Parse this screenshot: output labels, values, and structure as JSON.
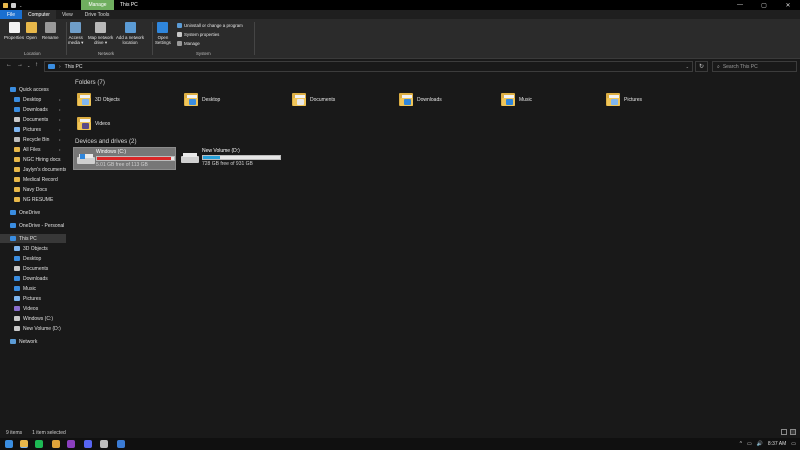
{
  "titlebar": {
    "title": "This PC",
    "manage_tab": "Manage",
    "drive_tools_tab": "Drive Tools",
    "quick_access_icons": [
      "properties-icon",
      "folder-icon",
      "page-icon",
      "dropdown-icon"
    ],
    "window_controls": {
      "minimize": "—",
      "maximize": "▢",
      "close": "✕"
    }
  },
  "tabs": [
    "File",
    "Computer",
    "View",
    "Drive Tools"
  ],
  "ribbon": {
    "location": {
      "label": "Location",
      "buttons": [
        {
          "label": "Properties",
          "icon": "properties-icon",
          "color": "#f2f2f2"
        },
        {
          "label": "Open",
          "icon": "open-folder-icon",
          "color": "#e8b84a"
        },
        {
          "label": "Rename",
          "icon": "rename-icon",
          "color": "#9a9a9a"
        }
      ]
    },
    "network": {
      "label": "Network",
      "buttons": [
        {
          "label": "Access\nmedia ▾",
          "icon": "access-media-icon",
          "color": "#6f9ec9"
        },
        {
          "label": "Map network\ndrive ▾",
          "icon": "map-network-drive-icon",
          "color": "#b9b9b9"
        },
        {
          "label": "Add a network\nlocation",
          "icon": "add-network-location-icon",
          "color": "#5b9bd5"
        }
      ]
    },
    "system": {
      "label": "System",
      "buttons": [
        {
          "label": "Open\nSettings",
          "icon": "settings-icon",
          "color": "#2f86dc"
        }
      ],
      "small": [
        "Uninstall or change a program",
        "System properties",
        "Manage"
      ]
    }
  },
  "address": {
    "crumb": "This PC",
    "search_placeholder": "Search This PC",
    "nav": {
      "back": "←",
      "forward": "→",
      "recent": "⌄",
      "up": "↑",
      "refresh": "↻",
      "search_icon": "⌕",
      "dropdown": "⌄"
    }
  },
  "navpane": {
    "pin_glyph": "📌",
    "items": [
      {
        "label": "Quick access",
        "icon": "star-icon",
        "color": "#3a8de0",
        "pinned": false,
        "selected": false
      },
      {
        "label": "Desktop",
        "icon": "desktop-icon",
        "color": "#3a8de0",
        "pinned": true,
        "selected": false
      },
      {
        "label": "Downloads",
        "icon": "downloads-icon",
        "color": "#3a8de0",
        "pinned": true,
        "selected": false
      },
      {
        "label": "Documents",
        "icon": "documents-icon",
        "color": "#c9c9c9",
        "pinned": true,
        "selected": false
      },
      {
        "label": "Pictures",
        "icon": "pictures-icon",
        "color": "#7fb6f0",
        "pinned": true,
        "selected": false
      },
      {
        "label": "Recycle Bin",
        "icon": "recycle-bin-icon",
        "color": "#bdbdbd",
        "pinned": true,
        "selected": false
      },
      {
        "label": "All Files",
        "icon": "folder-icon",
        "color": "#e8b84a",
        "pinned": true,
        "selected": false
      },
      {
        "label": "NGC Hiring docs",
        "icon": "folder-icon",
        "color": "#e8b84a",
        "pinned": false,
        "selected": false
      },
      {
        "label": "Jaylyn's documents",
        "icon": "folder-icon",
        "color": "#e8b84a",
        "pinned": false,
        "selected": false
      },
      {
        "label": "Medical Record",
        "icon": "folder-icon",
        "color": "#e8b84a",
        "pinned": false,
        "selected": false
      },
      {
        "label": "Navy Docs",
        "icon": "folder-icon",
        "color": "#e8b84a",
        "pinned": false,
        "selected": false
      },
      {
        "label": "NG RESUME",
        "icon": "folder-icon",
        "color": "#e8b84a",
        "pinned": false,
        "selected": false
      },
      {
        "label": "OneDrive",
        "icon": "onedrive-icon",
        "color": "#3a8de0",
        "pinned": false,
        "selected": false
      },
      {
        "label": "OneDrive - Personal",
        "icon": "onedrive-icon",
        "color": "#3a8de0",
        "pinned": false,
        "selected": false
      },
      {
        "label": "This PC",
        "icon": "this-pc-icon",
        "color": "#3a8de0",
        "pinned": false,
        "selected": true
      },
      {
        "label": "3D Objects",
        "icon": "3d-objects-icon",
        "color": "#7fb6f0",
        "pinned": false,
        "selected": false
      },
      {
        "label": "Desktop",
        "icon": "desktop-icon",
        "color": "#3a8de0",
        "pinned": false,
        "selected": false
      },
      {
        "label": "Documents",
        "icon": "documents-icon",
        "color": "#c9c9c9",
        "pinned": false,
        "selected": false
      },
      {
        "label": "Downloads",
        "icon": "downloads-icon",
        "color": "#3a8de0",
        "pinned": false,
        "selected": false
      },
      {
        "label": "Music",
        "icon": "music-icon",
        "color": "#3a8de0",
        "pinned": false,
        "selected": false
      },
      {
        "label": "Pictures",
        "icon": "pictures-icon",
        "color": "#7fb6f0",
        "pinned": false,
        "selected": false
      },
      {
        "label": "Videos",
        "icon": "videos-icon",
        "color": "#8a6fd0",
        "pinned": false,
        "selected": false
      },
      {
        "label": "Windows (C:)",
        "icon": "drive-icon",
        "color": "#c9c9c9",
        "pinned": false,
        "selected": false
      },
      {
        "label": "New Volume (D:)",
        "icon": "drive-icon",
        "color": "#c9c9c9",
        "pinned": false,
        "selected": false
      },
      {
        "label": "Network",
        "icon": "network-icon",
        "color": "#5b9bd5",
        "pinned": false,
        "selected": false
      }
    ]
  },
  "folders": {
    "heading": "Folders (7)",
    "items": [
      {
        "label": "3D Objects",
        "badge": "#7fb6f0"
      },
      {
        "label": "Desktop",
        "badge": "#3a8de0"
      },
      {
        "label": "Documents",
        "badge": "#e8e8e8"
      },
      {
        "label": "Downloads",
        "badge": "#2f86dc"
      },
      {
        "label": "Music",
        "badge": "#2f86dc"
      },
      {
        "label": "Pictures",
        "badge": "#7fb6f0"
      },
      {
        "label": "Videos",
        "badge": "#5a4a8a"
      }
    ]
  },
  "drives": {
    "heading": "Devices and drives (2)",
    "items": [
      {
        "label": "Windows (C:)",
        "free": "5.01 GB free of 113 GB",
        "used_fraction": 0.956,
        "bar_color": "#da2626",
        "selected": true
      },
      {
        "label": "New Volume (D:)",
        "free": "728 GB free of 931 GB",
        "used_fraction": 0.218,
        "bar_color": "#26a0da",
        "selected": false
      }
    ]
  },
  "statusbar": {
    "count": "9 items",
    "selected": "1 item selected"
  },
  "taskbar": {
    "apps": [
      {
        "icon": "windows-start-icon",
        "color": "#3a8de0"
      },
      {
        "icon": "file-explorer-icon",
        "color": "#e8b84a"
      },
      {
        "icon": "spotify-icon",
        "color": "#1db954"
      },
      {
        "icon": "chrome-icon",
        "color": "#e0a43a"
      },
      {
        "icon": "app-purple-icon",
        "color": "#8b3fbf"
      },
      {
        "icon": "discord-icon",
        "color": "#5865f2"
      },
      {
        "icon": "settings-gear-icon",
        "color": "#bdbdbd"
      },
      {
        "icon": "app-blue-icon",
        "color": "#3a7bd5"
      }
    ],
    "tray": {
      "chevron": "^",
      "volume": "🔊",
      "network": "▭",
      "time": "8:37 AM",
      "notifications": "▭"
    }
  }
}
